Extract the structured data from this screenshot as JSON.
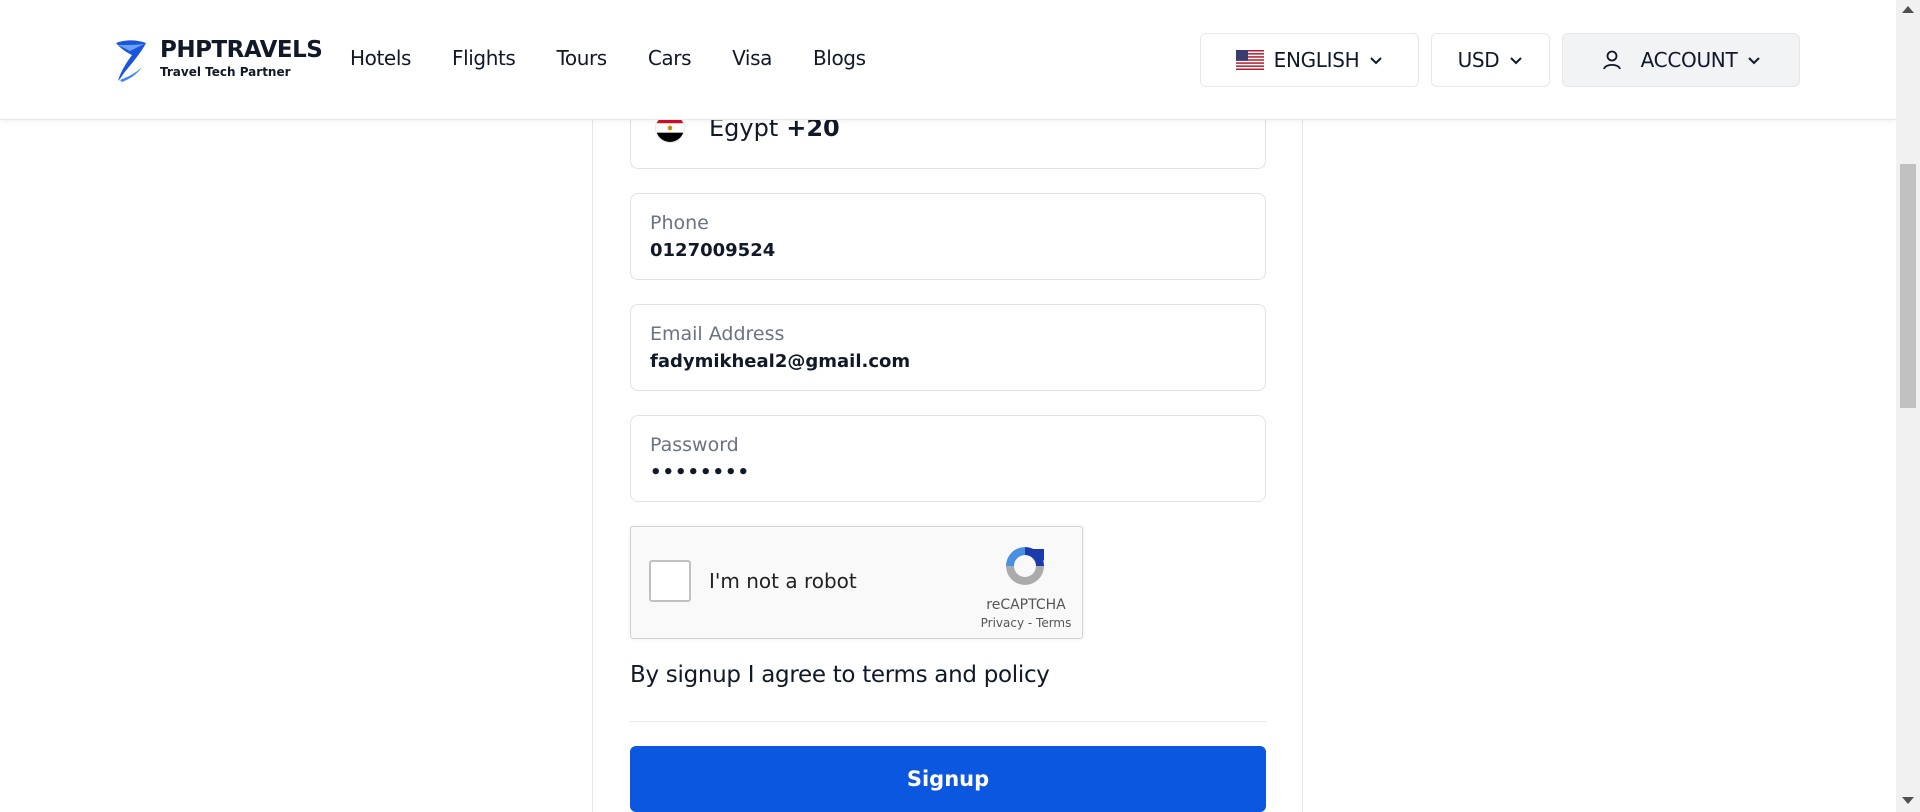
{
  "brand": {
    "name": "PHPTRAVELS",
    "tagline": "Travel Tech Partner",
    "accent": "#0b57e0"
  },
  "nav": {
    "items": [
      {
        "label": "Hotels"
      },
      {
        "label": "Flights"
      },
      {
        "label": "Tours"
      },
      {
        "label": "Cars"
      },
      {
        "label": "Visa"
      },
      {
        "label": "Blogs"
      }
    ]
  },
  "header": {
    "language": "ENGLISH",
    "language_flag": "us-flag-icon",
    "currency": "USD",
    "account": "ACCOUNT"
  },
  "form": {
    "country": {
      "name": "Egypt",
      "code": "+20",
      "flag": "egypt-flag-icon"
    },
    "phone": {
      "label": "Phone",
      "value": "0127009524"
    },
    "email": {
      "label": "Email Address",
      "value": "fadymikheal2@gmail.com"
    },
    "password": {
      "label": "Password",
      "value": "••••••••"
    },
    "recaptcha": {
      "label": "I'm not a robot",
      "brand": "reCAPTCHA",
      "privacy": "Privacy",
      "separator": " - ",
      "terms": "Terms"
    },
    "agree_text": "By signup I agree to terms and policy",
    "submit_label": "Signup"
  }
}
